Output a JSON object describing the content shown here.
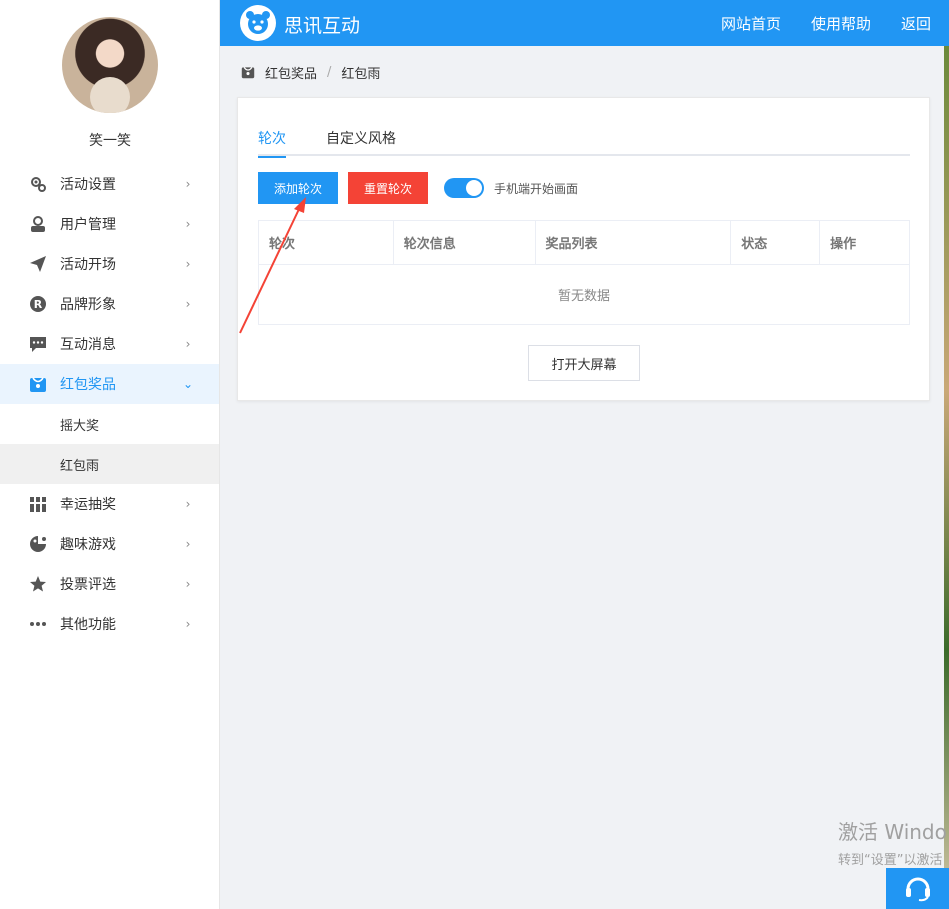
{
  "header": {
    "brand": "思讯互动",
    "nav": [
      "网站首页",
      "使用帮助",
      "返回"
    ]
  },
  "user": {
    "name": "笑一笑"
  },
  "sidebar": {
    "items": [
      {
        "label": "活动设置",
        "icon": "gear-icon"
      },
      {
        "label": "用户管理",
        "icon": "user-icon"
      },
      {
        "label": "活动开场",
        "icon": "paper-plane-icon"
      },
      {
        "label": "品牌形象",
        "icon": "registered-icon"
      },
      {
        "label": "互动消息",
        "icon": "chat-icon"
      },
      {
        "label": "红包奖品",
        "icon": "gift-box-icon",
        "expanded": true
      },
      {
        "label": "幸运抽奖",
        "icon": "lottery-icon"
      },
      {
        "label": "趣味游戏",
        "icon": "game-icon"
      },
      {
        "label": "投票评选",
        "icon": "star-icon"
      },
      {
        "label": "其他功能",
        "icon": "more-icon"
      }
    ],
    "sub_items": [
      "摇大奖",
      "红包雨"
    ],
    "current_sub": "红包雨"
  },
  "breadcrumb": {
    "parent": "红包奖品",
    "current": "红包雨",
    "separator": "/"
  },
  "tabs": [
    "轮次",
    "自定义风格"
  ],
  "actions": {
    "add": "添加轮次",
    "reset": "重置轮次",
    "toggle_label": "手机端开始画面",
    "toggle_on": true
  },
  "table": {
    "columns": [
      "轮次",
      "轮次信息",
      "奖品列表",
      "状态",
      "操作"
    ],
    "empty_text": "暂无数据"
  },
  "open_screen": "打开大屏幕",
  "watermark": {
    "line1": "激活 Windo",
    "line2": "转到“设置”以激活"
  },
  "colors": {
    "primary": "#2196f3",
    "danger": "#f44336"
  }
}
